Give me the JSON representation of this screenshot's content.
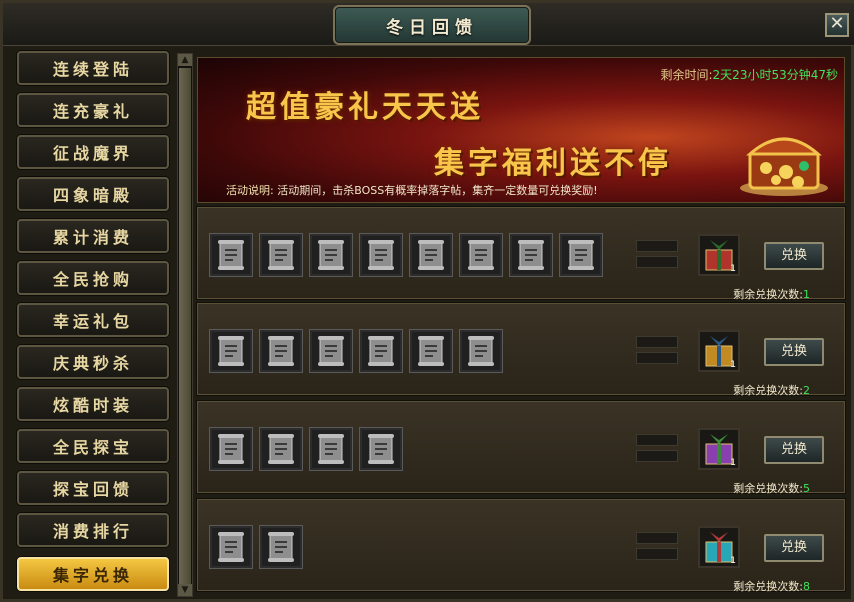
{
  "window": {
    "title": "冬日回馈",
    "close_label": "✕"
  },
  "sidebar": {
    "items": [
      {
        "label": "连续登陆"
      },
      {
        "label": "连充豪礼"
      },
      {
        "label": "征战魔界"
      },
      {
        "label": "四象暗殿"
      },
      {
        "label": "累计消费"
      },
      {
        "label": "全民抢购"
      },
      {
        "label": "幸运礼包"
      },
      {
        "label": "庆典秒杀"
      },
      {
        "label": "炫酷时装"
      },
      {
        "label": "全民探宝"
      },
      {
        "label": "探宝回馈"
      },
      {
        "label": "消费排行"
      },
      {
        "label": "集字兑换",
        "active": true
      }
    ]
  },
  "banner": {
    "headline1": "超值豪礼天天送",
    "headline2": "集字福利送不停",
    "timer_label": "剩余时间:",
    "timer_value": "2天23小时53分钟47秒",
    "desc_label": "活动说明:",
    "desc_text": "活动期间，击杀BOSS有概率掉落字帖，集齐一定数量可兑换奖励!"
  },
  "rows": [
    {
      "slots": 8,
      "gift_qty": "1",
      "gift_color": "#b0342c",
      "button": "兑换",
      "remain_label": "剩余兑换次数:",
      "remain_count": "1"
    },
    {
      "slots": 6,
      "gift_qty": "1",
      "gift_color": "#c28a22",
      "button": "兑换",
      "remain_label": "剩余兑换次数:",
      "remain_count": "2"
    },
    {
      "slots": 4,
      "gift_qty": "1",
      "gift_color": "#8a3fae",
      "button": "兑换",
      "remain_label": "剩余兑换次数:",
      "remain_count": "5"
    },
    {
      "slots": 2,
      "gift_qty": "1",
      "gift_color": "#2aa7b6",
      "button": "兑换",
      "remain_label": "剩余兑换次数:",
      "remain_count": "8"
    }
  ],
  "colors": {
    "accent_gold": "#f4c742",
    "count_green": "#3fe35a"
  }
}
